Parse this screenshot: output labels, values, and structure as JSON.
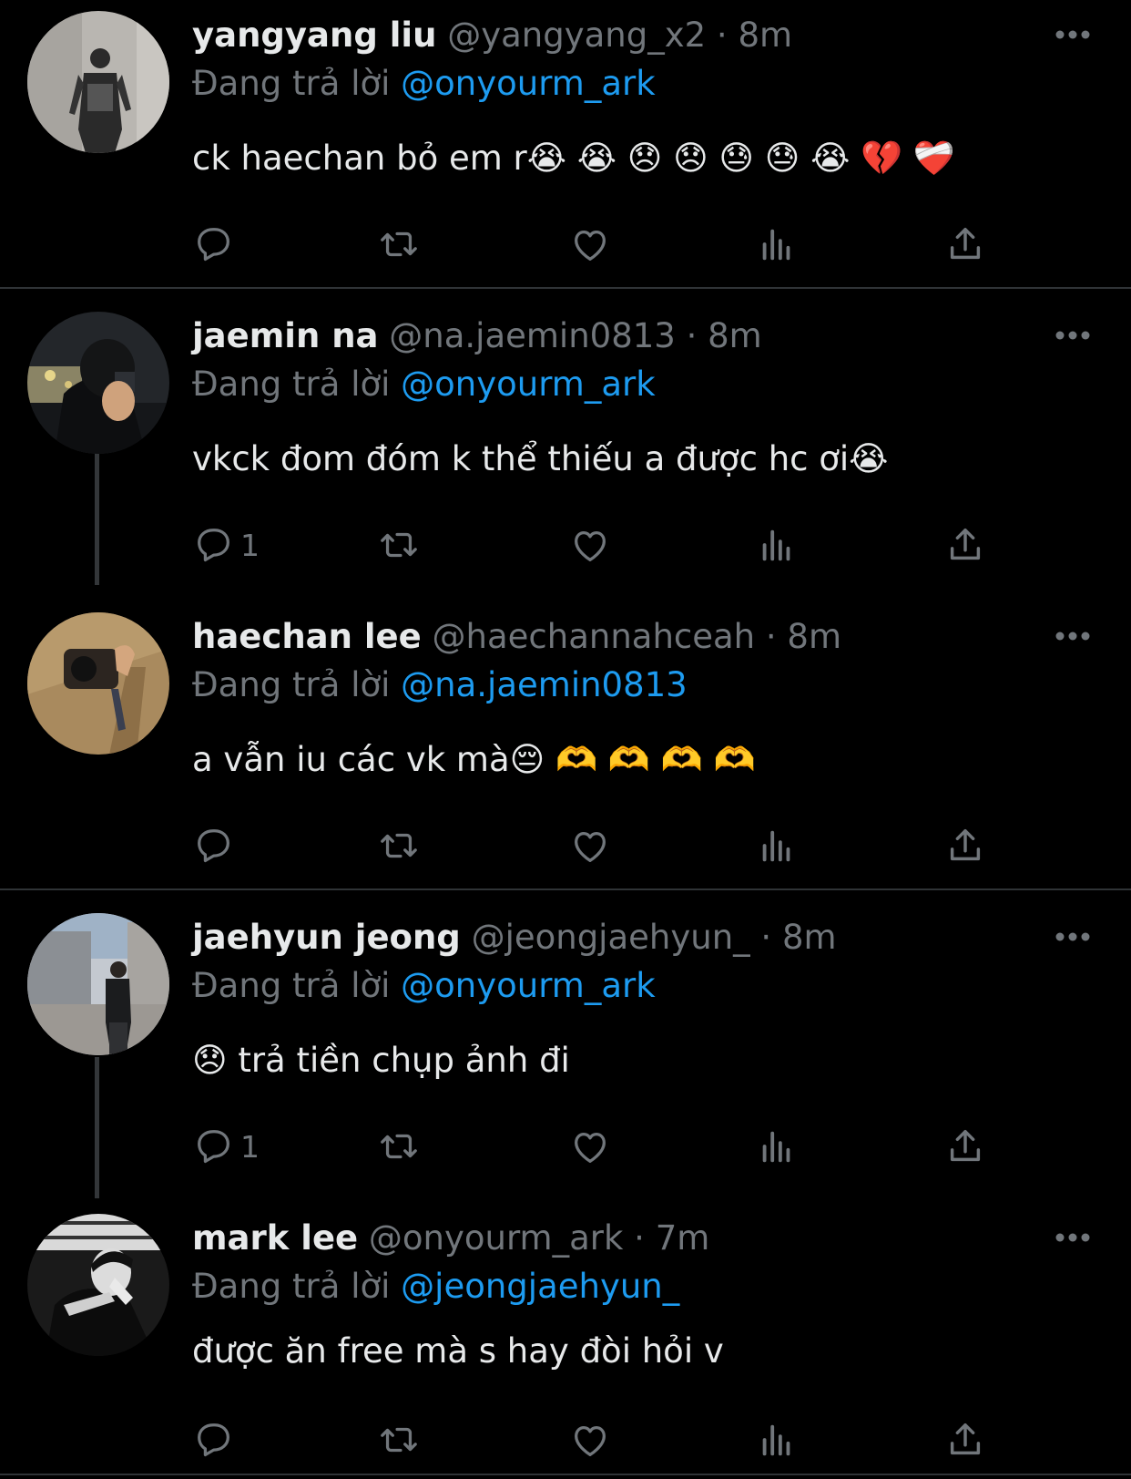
{
  "reply_prefix": "Đang trả lời",
  "tweets": [
    {
      "name": "yangyang liu",
      "handle": "@yangyang_x2",
      "time": "8m",
      "reply_to": "@onyourm_ark",
      "text": "ck haechan bỏ em r😭 😭 😞 😞 😓 😓 😭 💔 ❤️‍🩹",
      "reply_count": ""
    },
    {
      "name": "jaemin na",
      "handle": "@na.jaemin0813",
      "time": "8m",
      "reply_to": "@onyourm_ark",
      "text": "vkck đom đóm k thể thiếu a được hc ơi😭",
      "reply_count": "1"
    },
    {
      "name": "haechan lee",
      "handle": "@haechannahceah",
      "time": "8m",
      "reply_to": "@na.jaemin0813",
      "text": "a vẫn iu các vk mà😔 🫶 🫶 🫶 🫶",
      "reply_count": ""
    },
    {
      "name": "jaehyun jeong",
      "handle": "@jeongjaehyun_",
      "time": "8m",
      "reply_to": "@onyourm_ark",
      "text": "😞 trả tiền chụp ảnh đi",
      "reply_count": "1"
    },
    {
      "name": "mark lee",
      "handle": "@onyourm_ark",
      "time": "7m",
      "reply_to": "@jeongjaehyun_",
      "text": "được ăn free mà s hay đòi hỏi v",
      "reply_count": ""
    }
  ],
  "icons": {
    "reply": "reply-icon",
    "retweet": "retweet-icon",
    "like": "heart-icon",
    "views": "views-icon",
    "share": "share-icon",
    "more": "more-icon"
  },
  "colors": {
    "background": "#000000",
    "text": "#e7e9ea",
    "secondary": "#71767b",
    "link": "#1d9bf0",
    "divider": "#2f3336"
  }
}
